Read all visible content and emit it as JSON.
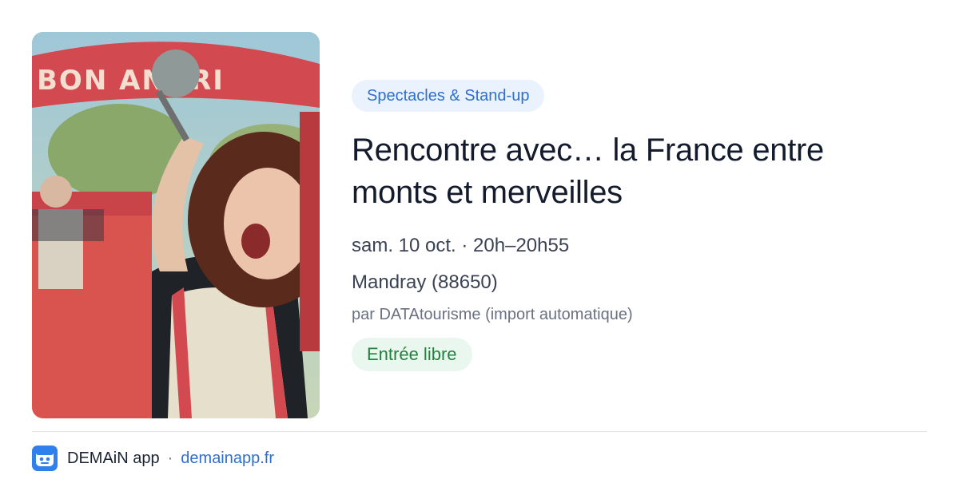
{
  "card": {
    "image": {
      "alt_icon": "event-photo",
      "sign_text": "BON ANDRI"
    },
    "category": "Spectacles & Stand-up",
    "title": "Rencontre avec… la France entre monts et merveilles",
    "date": "sam. 10 oct. · 20h–20h55",
    "location": "Mandray (88650)",
    "source": "par DATAtourisme (import automatique)",
    "price": "Entrée libre"
  },
  "footer": {
    "app_icon": "demain-app-logo-icon",
    "app_name": "DEMAiN app",
    "separator": "·",
    "link": "demainapp.fr"
  },
  "colors": {
    "category_bg": "#eaf2fd",
    "category_text": "#2f6fd0",
    "price_bg": "#eaf7ee",
    "price_text": "#22823f",
    "link": "#2f6fd0",
    "app_icon_bg": "#2f80ed"
  }
}
